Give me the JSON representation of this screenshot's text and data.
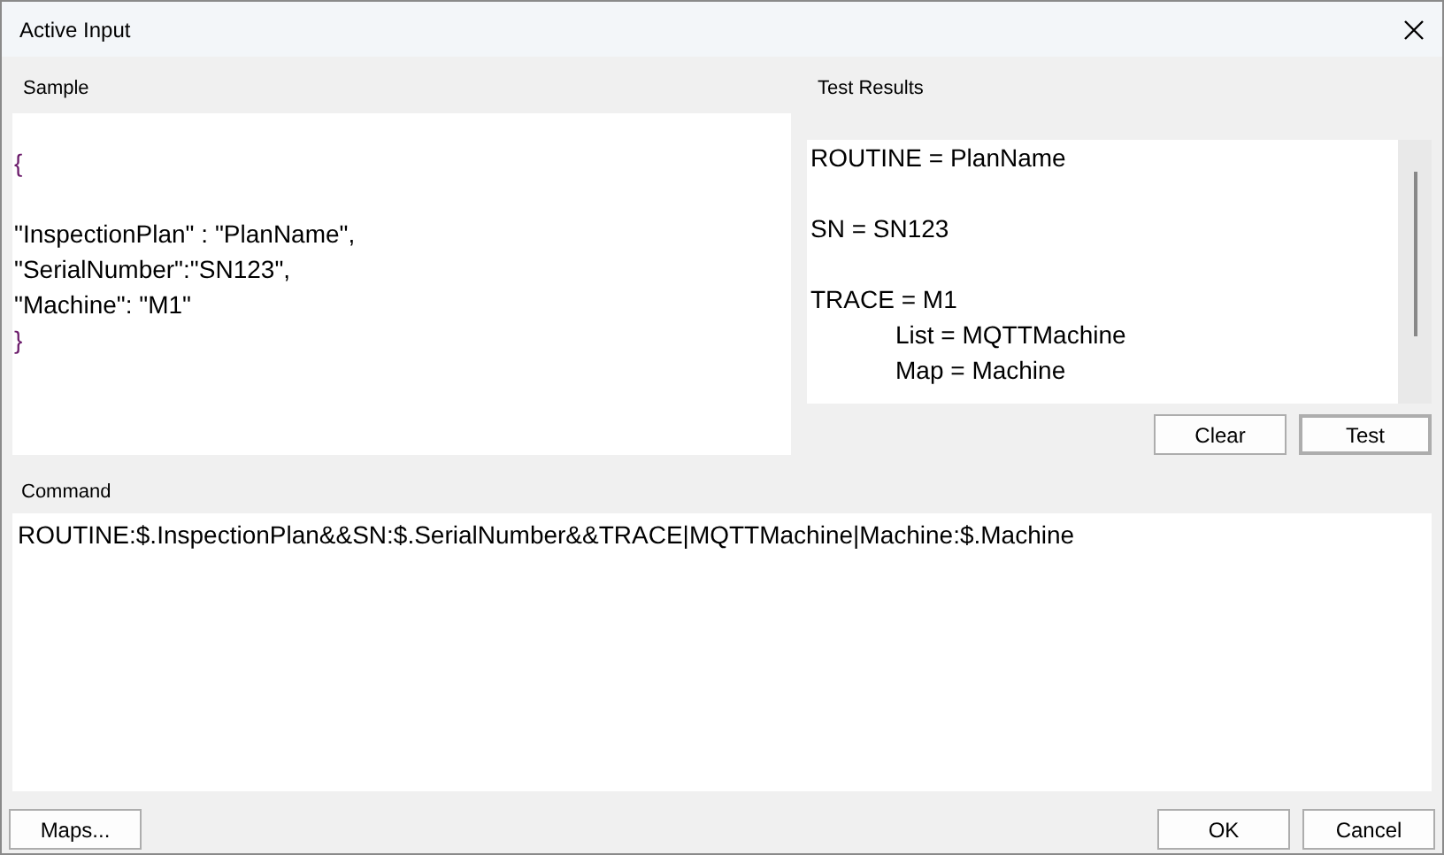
{
  "window": {
    "title": "Active Input"
  },
  "sample": {
    "label": "Sample",
    "lines": [
      {
        "kind": "brace",
        "text": "{"
      },
      {
        "kind": "blank"
      },
      {
        "kind": "text",
        "text": "\"InspectionPlan\" : \"PlanName\","
      },
      {
        "kind": "text",
        "text": "\"SerialNumber\":\"SN123\","
      },
      {
        "kind": "text",
        "text": "\"Machine\": \"M1\""
      },
      {
        "kind": "brace",
        "text": "}"
      }
    ]
  },
  "test_results": {
    "label": "Test Results",
    "lines": [
      {
        "kind": "text",
        "text": "ROUTINE = PlanName"
      },
      {
        "kind": "blank"
      },
      {
        "kind": "text",
        "text": "SN = SN123"
      },
      {
        "kind": "blank"
      },
      {
        "kind": "text",
        "text": "TRACE = M1",
        "children": [
          {
            "text": "List = MQTTMachine"
          },
          {
            "text": "Map = Machine"
          }
        ]
      }
    ],
    "buttons": [
      {
        "label": "Clear",
        "default": false
      },
      {
        "label": "Test",
        "default": true
      }
    ]
  },
  "command": {
    "label": "Command",
    "value": "ROUTINE:$.InspectionPlan&&SN:$.SerialNumber&&TRACE|MQTTMachine|Machine:$.Machine"
  },
  "footer_buttons": {
    "left": [
      {
        "label": "Maps...",
        "default": false
      }
    ],
    "right": [
      {
        "label": "OK",
        "default": false
      },
      {
        "label": "Cancel",
        "default": false
      }
    ]
  }
}
